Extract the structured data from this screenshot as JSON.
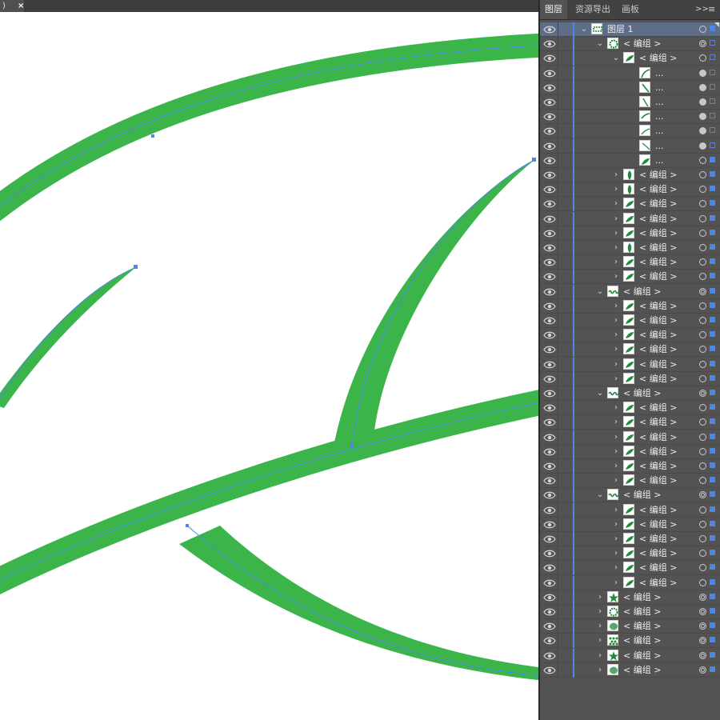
{
  "doc_tab": {
    "label": ")",
    "close": "×"
  },
  "panel": {
    "tabs": [
      "图层",
      "资源导出",
      "画板"
    ],
    "expand_icon": ">>",
    "menu_icon": "≡"
  },
  "layers": [
    {
      "depth": 0,
      "chev": "down",
      "thumb": "bar",
      "label": "图层 1",
      "selected": true,
      "target": "ring",
      "square": true
    },
    {
      "depth": 1,
      "chev": "down",
      "thumb": "ring",
      "label": "< 编组 >",
      "target": "double",
      "square": false
    },
    {
      "depth": 2,
      "chev": "down",
      "thumb": "leaf",
      "label": "< 编组 >",
      "target": "ring",
      "square": false
    },
    {
      "depth": 3,
      "chev": "none",
      "thumb": "curveA",
      "label": "...",
      "target": "filled",
      "square": false
    },
    {
      "depth": 3,
      "chev": "none",
      "thumb": "curveB",
      "label": "...",
      "target": "filled",
      "square": false
    },
    {
      "depth": 3,
      "chev": "none",
      "thumb": "curveC",
      "label": "...",
      "target": "filled",
      "square": false
    },
    {
      "depth": 3,
      "chev": "none",
      "thumb": "curveD",
      "label": "...",
      "target": "filled",
      "square": false
    },
    {
      "depth": 3,
      "chev": "none",
      "thumb": "curveE",
      "label": "...",
      "target": "filled",
      "square": false
    },
    {
      "depth": 3,
      "chev": "none",
      "thumb": "curveF",
      "label": "...",
      "target": "filled",
      "square": false
    },
    {
      "depth": 3,
      "chev": "none",
      "thumb": "curveG",
      "label": "...",
      "target": "ring",
      "square": true
    },
    {
      "depth": 2,
      "chev": "right",
      "thumb": "leafV",
      "label": "< 编组 >",
      "target": "ring",
      "square": true
    },
    {
      "depth": 2,
      "chev": "right",
      "thumb": "leafV",
      "label": "< 编组 >",
      "target": "ring",
      "square": true
    },
    {
      "depth": 2,
      "chev": "right",
      "thumb": "leaf",
      "label": "< 编组 >",
      "target": "ring",
      "square": true
    },
    {
      "depth": 2,
      "chev": "right",
      "thumb": "leaf",
      "label": "< 编组 >",
      "target": "ring",
      "square": true
    },
    {
      "depth": 2,
      "chev": "right",
      "thumb": "leaf",
      "label": "< 编组 >",
      "target": "ring",
      "square": true
    },
    {
      "depth": 2,
      "chev": "right",
      "thumb": "leafV",
      "label": "< 编组 >",
      "target": "ring",
      "square": true
    },
    {
      "depth": 2,
      "chev": "right",
      "thumb": "leaf",
      "label": "< 编组 >",
      "target": "ring",
      "square": true
    },
    {
      "depth": 2,
      "chev": "right",
      "thumb": "leaf",
      "label": "< 编组 >",
      "target": "ring",
      "square": true
    },
    {
      "depth": 1,
      "chev": "down",
      "thumb": "wave",
      "label": "< 编组 >",
      "target": "double",
      "square": true
    },
    {
      "depth": 2,
      "chev": "right",
      "thumb": "leaf",
      "label": "< 编组 >",
      "target": "ring",
      "square": true
    },
    {
      "depth": 2,
      "chev": "right",
      "thumb": "leaf",
      "label": "< 编组 >",
      "target": "ring",
      "square": true
    },
    {
      "depth": 2,
      "chev": "right",
      "thumb": "leaf",
      "label": "< 编组 >",
      "target": "ring",
      "square": true
    },
    {
      "depth": 2,
      "chev": "right",
      "thumb": "leaf",
      "label": "< 编组 >",
      "target": "ring",
      "square": true
    },
    {
      "depth": 2,
      "chev": "right",
      "thumb": "leaf",
      "label": "< 编组 >",
      "target": "ring",
      "square": true
    },
    {
      "depth": 2,
      "chev": "right",
      "thumb": "leaf",
      "label": "< 编组 >",
      "target": "ring",
      "square": true
    },
    {
      "depth": 1,
      "chev": "down",
      "thumb": "wave",
      "label": "< 编组 >",
      "target": "double",
      "square": true
    },
    {
      "depth": 2,
      "chev": "right",
      "thumb": "leaf",
      "label": "< 编组 >",
      "target": "ring",
      "square": true
    },
    {
      "depth": 2,
      "chev": "right",
      "thumb": "leaf",
      "label": "< 编组 >",
      "target": "ring",
      "square": true
    },
    {
      "depth": 2,
      "chev": "right",
      "thumb": "leaf",
      "label": "< 编组 >",
      "target": "ring",
      "square": true
    },
    {
      "depth": 2,
      "chev": "right",
      "thumb": "leaf",
      "label": "< 编组 >",
      "target": "ring",
      "square": true
    },
    {
      "depth": 2,
      "chev": "right",
      "thumb": "leaf",
      "label": "< 编组 >",
      "target": "ring",
      "square": true
    },
    {
      "depth": 2,
      "chev": "right",
      "thumb": "leaf",
      "label": "< 编组 >",
      "target": "ring",
      "square": true
    },
    {
      "depth": 1,
      "chev": "down",
      "thumb": "wave",
      "label": "< 编组 >",
      "target": "double",
      "square": true
    },
    {
      "depth": 2,
      "chev": "right",
      "thumb": "leaf",
      "label": "< 编组 >",
      "target": "ring",
      "square": true
    },
    {
      "depth": 2,
      "chev": "right",
      "thumb": "leaf",
      "label": "< 编组 >",
      "target": "ring",
      "square": true
    },
    {
      "depth": 2,
      "chev": "right",
      "thumb": "leaf",
      "label": "< 编组 >",
      "target": "ring",
      "square": true
    },
    {
      "depth": 2,
      "chev": "right",
      "thumb": "leaf",
      "label": "< 编组 >",
      "target": "ring",
      "square": true
    },
    {
      "depth": 2,
      "chev": "right",
      "thumb": "leaf",
      "label": "< 编组 >",
      "target": "ring",
      "square": true
    },
    {
      "depth": 2,
      "chev": "right",
      "thumb": "leaf",
      "label": "< 编组 >",
      "target": "ring",
      "square": true
    },
    {
      "depth": 1,
      "chev": "right",
      "thumb": "star",
      "label": "< 编组 >",
      "target": "double",
      "square": true
    },
    {
      "depth": 1,
      "chev": "right",
      "thumb": "ring",
      "label": "< 编组 >",
      "target": "double",
      "square": true
    },
    {
      "depth": 1,
      "chev": "right",
      "thumb": "blob",
      "label": "< 编组 >",
      "target": "double",
      "square": true
    },
    {
      "depth": 1,
      "chev": "right",
      "thumb": "dots",
      "label": "< 编组 >",
      "target": "double",
      "square": true
    },
    {
      "depth": 1,
      "chev": "right",
      "thumb": "star",
      "label": "< 编组 >",
      "target": "double",
      "square": true
    },
    {
      "depth": 1,
      "chev": "right",
      "thumb": "blob",
      "label": "< 编组 >",
      "target": "double",
      "square": true
    }
  ],
  "colors": {
    "stroke_green": "#3bb54a",
    "path_blue": "#4d86e6",
    "panel_bg": "#535353",
    "row_selected": "#5f6e87",
    "leaf_green": "#1e8a3c"
  },
  "icons": {
    "visibility": "eye-icon",
    "expand": "chevron-icon",
    "target": "target-circle-icon",
    "selection": "selection-square-icon"
  }
}
